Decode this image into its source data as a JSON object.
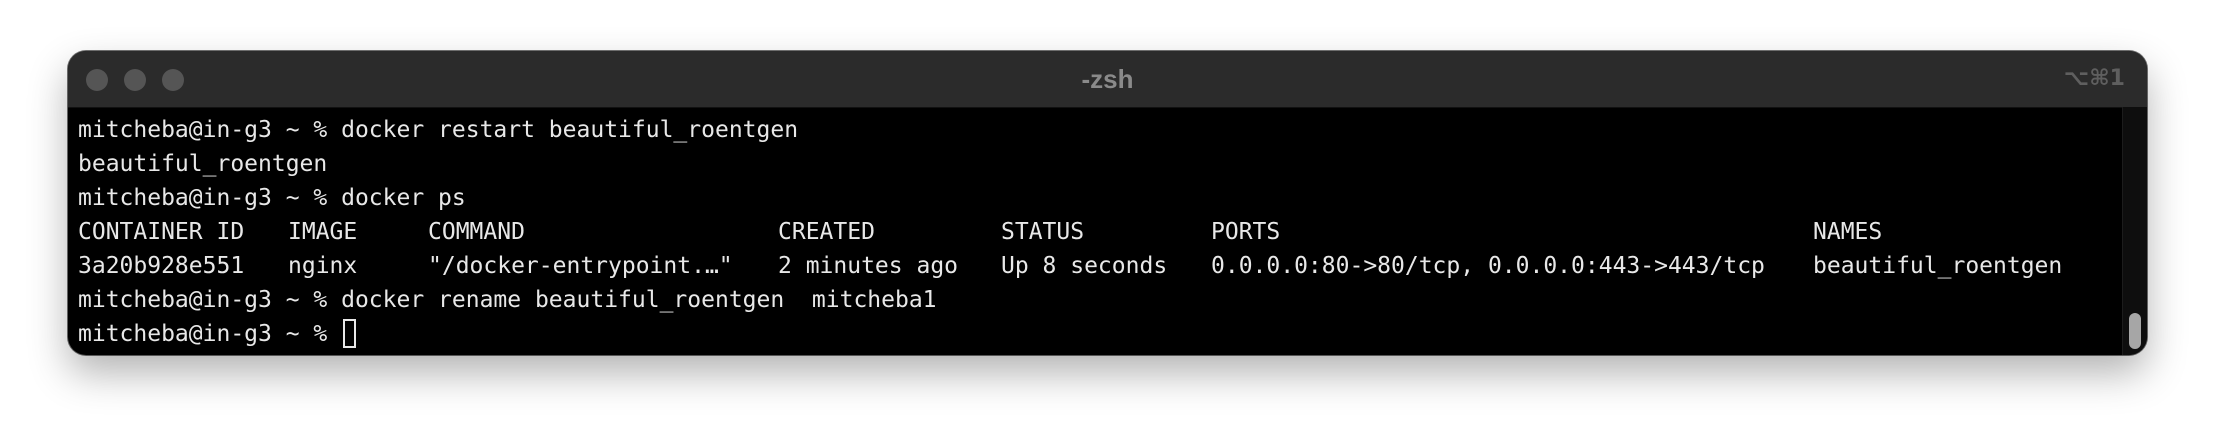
{
  "window": {
    "title": "-zsh",
    "shortcut": "⌥⌘1"
  },
  "terminal": {
    "lines": [
      "mitcheba@in-g3 ~ % docker restart beautiful_roentgen",
      "beautiful_roentgen",
      "mitcheba@in-g3 ~ % docker ps",
      "mitcheba@in-g3 ~ % docker rename beautiful_roentgen  mitcheba1",
      "mitcheba@in-g3 ~ % "
    ],
    "table": {
      "headers": [
        "CONTAINER ID",
        "IMAGE",
        "COMMAND",
        "CREATED",
        "STATUS",
        "PORTS",
        "NAMES"
      ],
      "row": [
        "3a20b928e551",
        "nginx",
        "\"/docker-entrypoint.…\"",
        "2 minutes ago",
        "Up 8 seconds",
        "0.0.0.0:80->80/tcp, 0.0.0.0:443->443/tcp",
        "beautiful_roentgen"
      ]
    }
  },
  "colors": {
    "terminal_background": "#000000",
    "terminal_text": "#e8e8e8",
    "titlebar": "#2b2b2b",
    "title_text": "#8a8a8a"
  }
}
